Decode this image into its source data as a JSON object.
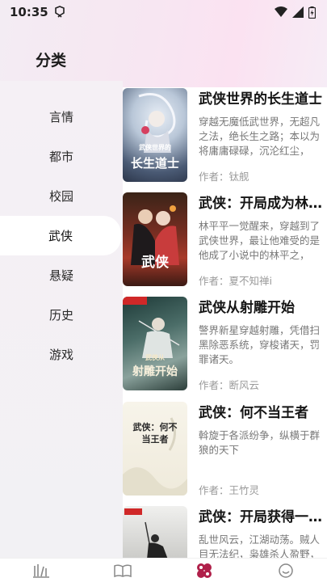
{
  "status": {
    "time": "10:35"
  },
  "header": {
    "title": "分类"
  },
  "categories": [
    {
      "label": "言情",
      "active": false
    },
    {
      "label": "都市",
      "active": false
    },
    {
      "label": "校园",
      "active": false
    },
    {
      "label": "武侠",
      "active": true
    },
    {
      "label": "悬疑",
      "active": false
    },
    {
      "label": "历史",
      "active": false
    },
    {
      "label": "游戏",
      "active": false
    }
  ],
  "books": [
    {
      "title": "武侠世界的长生道士",
      "desc": "穿越无魔低武世界，无超凡之法，绝长生之路；本以为将庸庸碌碌，沉沦红尘，",
      "author": "作者：钛舰",
      "cover_text": "长生道士",
      "cover_sub": "武侠世界的"
    },
    {
      "title": "武侠：开局成为林平之",
      "desc": "林平平一觉醒来，穿越到了武侠世界，最让他难受的是他成了小说中的林平之，",
      "author": "作者：夏不知禅i",
      "cover_text": "武侠"
    },
    {
      "title": "武侠从射雕开始",
      "desc": "警界新星穿越射雕，凭借扫黑除恶系统，穿梭诸天，罚罪诸天。",
      "author": "作者：断风云",
      "cover_text": "射雕开始",
      "cover_sub": "武侠从"
    },
    {
      "title": "武侠：何不当王者",
      "desc": "斡旋于各派纷争，纵横于群狼的天下",
      "author": "作者：王竹灵",
      "cover_text": "武侠：何不当王者"
    },
    {
      "title": "武侠：开局获得一身内力",
      "desc": "乱世风云，江湖动荡。贼人目无法纪，枭雄杀人盈野，",
      "author": "作者：",
      "cover_text": ""
    }
  ],
  "tabs": [
    {
      "icon": "bookshelf-icon"
    },
    {
      "icon": "book-open-icon"
    },
    {
      "icon": "category-icon",
      "active": true
    },
    {
      "icon": "profile-icon"
    }
  ],
  "colors": {
    "accent": "#b0204a",
    "active_tab": "#b0204a"
  }
}
